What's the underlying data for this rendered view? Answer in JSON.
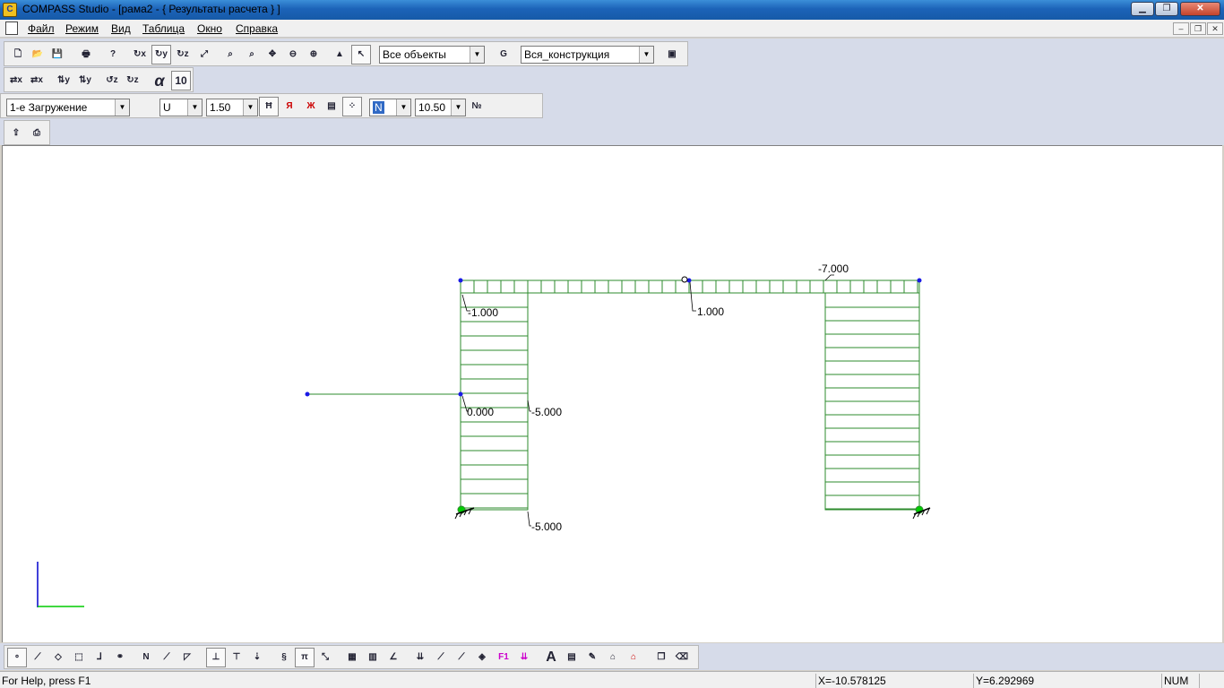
{
  "window": {
    "title": "COMPASS  Studio - [рама2 - { Результаты расчета } ]",
    "app_icon_glyph": "C"
  },
  "menu": [
    "Файл",
    "Режим",
    "Вид",
    "Таблица",
    "Окно",
    "Справка"
  ],
  "toolbar1": {
    "objects_select": "Все объекты",
    "construction_select": "Вся_конструкция"
  },
  "toolbar2": {
    "alpha_label": "α",
    "alpha_value": "10"
  },
  "toolbar3": {
    "load_case": "1-е Загружение",
    "result_component": "U",
    "scale": "1.50",
    "force_component": "N",
    "font_size": "10.50"
  },
  "diagram": {
    "labels": {
      "left_col_top": "-1.000",
      "mid_beam": "1.000",
      "right_top": "-7.000",
      "left_node_mid": "0.000",
      "left_col_mid": "-5.000",
      "left_col_bottom": "-5.000"
    }
  },
  "status": {
    "help": "For Help, press F1",
    "x": "X=-10.578125",
    "y": "Y=6.292969",
    "num": "NUM"
  },
  "colors": {
    "diagram": "#2e8b2e",
    "node": "#1a1ae6",
    "axis_x": "#00cc00",
    "axis_y": "#0000cc"
  },
  "icons": {
    "toolbar1": [
      "new-icon",
      "open-icon",
      "save-icon",
      "print-icon",
      "help-icon",
      "rotate-x-icon",
      "rotate-y-icon",
      "rotate-z-icon",
      "rotate-xy-icon",
      "zoom-window-icon",
      "zoom-all-icon",
      "pan-icon",
      "zoom-out-icon",
      "zoom-in-icon",
      "label-icon",
      "select-arrow-icon",
      "group-icon",
      "properties-icon"
    ],
    "toolbar2": [
      "rotate-x-left-icon",
      "rotate-x-right-icon",
      "rotate-y-left-icon",
      "rotate-y-right-icon",
      "rotate-z-left-icon",
      "rotate-z-right-icon"
    ],
    "toolbar3": [
      "diagram-fill-icon",
      "diagram-label-icon",
      "diagram-values-icon",
      "diagram-settings-icon",
      "grid-icon",
      "legend-icon"
    ],
    "toolbar4": [
      "export-icon",
      "report-icon"
    ]
  }
}
